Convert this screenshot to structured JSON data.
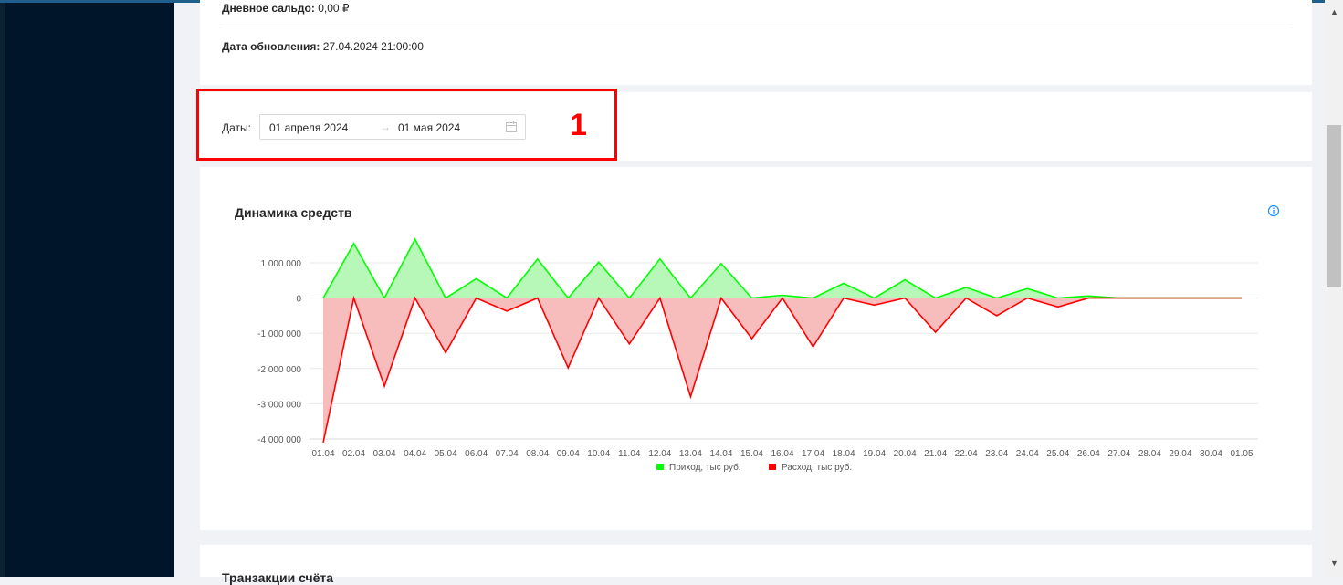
{
  "account_info": {
    "daily_balance_label": "Дневное сальдо:",
    "daily_balance_value": "0,00 ₽",
    "update_date_label": "Дата обновления:",
    "update_date_value": "27.04.2024 21:00:00"
  },
  "date_filter": {
    "label": "Даты",
    "label_colon": ":",
    "start": "01 апреля 2024",
    "separator": "→",
    "end": "01 мая 2024",
    "icon": "calendar-icon"
  },
  "annotation": {
    "marker_text": "1",
    "color": "#ff0000"
  },
  "chart_card": {
    "title": "Динамика средств",
    "info_icon": "info-circle-icon"
  },
  "chart_data": {
    "type": "area",
    "title": "Динамика средств",
    "categories": [
      "01.04",
      "02.04",
      "03.04",
      "04.04",
      "05.04",
      "06.04",
      "07.04",
      "08.04",
      "09.04",
      "10.04",
      "11.04",
      "12.04",
      "13.04",
      "14.04",
      "15.04",
      "16.04",
      "17.04",
      "18.04",
      "19.04",
      "20.04",
      "21.04",
      "22.04",
      "23.04",
      "24.04",
      "25.04",
      "26.04",
      "27.04",
      "28.04",
      "29.04",
      "30.04",
      "01.05"
    ],
    "ylim": [
      -4000000,
      1700000
    ],
    "yticks": [
      1000000,
      0,
      -1000000,
      -2000000,
      -3000000,
      -4000000
    ],
    "ytick_labels": [
      "1 000 000",
      "0",
      "-1 000 000",
      "-2 000 000",
      "-3 000 000",
      "-4 000 000"
    ],
    "grid": true,
    "legend_position": "bottom",
    "series": [
      {
        "name": "Приход, тыс руб.",
        "color": "#00ff00",
        "fill": "#b7f7b7",
        "values": [
          0,
          1550000,
          0,
          1670000,
          0,
          550000,
          0,
          1110000,
          0,
          1020000,
          0,
          1110000,
          0,
          980000,
          0,
          80000,
          0,
          420000,
          0,
          520000,
          0,
          300000,
          0,
          270000,
          0,
          60000,
          0,
          0,
          0,
          0,
          0
        ]
      },
      {
        "name": "Расход, тыс руб.",
        "color": "#ff0000",
        "fill": "#f7bcbc",
        "values": [
          -4100000,
          0,
          -2500000,
          0,
          -1550000,
          0,
          -370000,
          0,
          -1980000,
          0,
          -1300000,
          0,
          -2800000,
          0,
          -1150000,
          0,
          -1380000,
          0,
          -200000,
          0,
          -970000,
          0,
          -500000,
          0,
          -250000,
          0,
          0,
          0,
          0,
          0,
          0
        ]
      }
    ]
  },
  "next_card": {
    "title": "Транзакции счёта"
  },
  "scrollbar": {
    "up": "▲",
    "down": "▼"
  }
}
